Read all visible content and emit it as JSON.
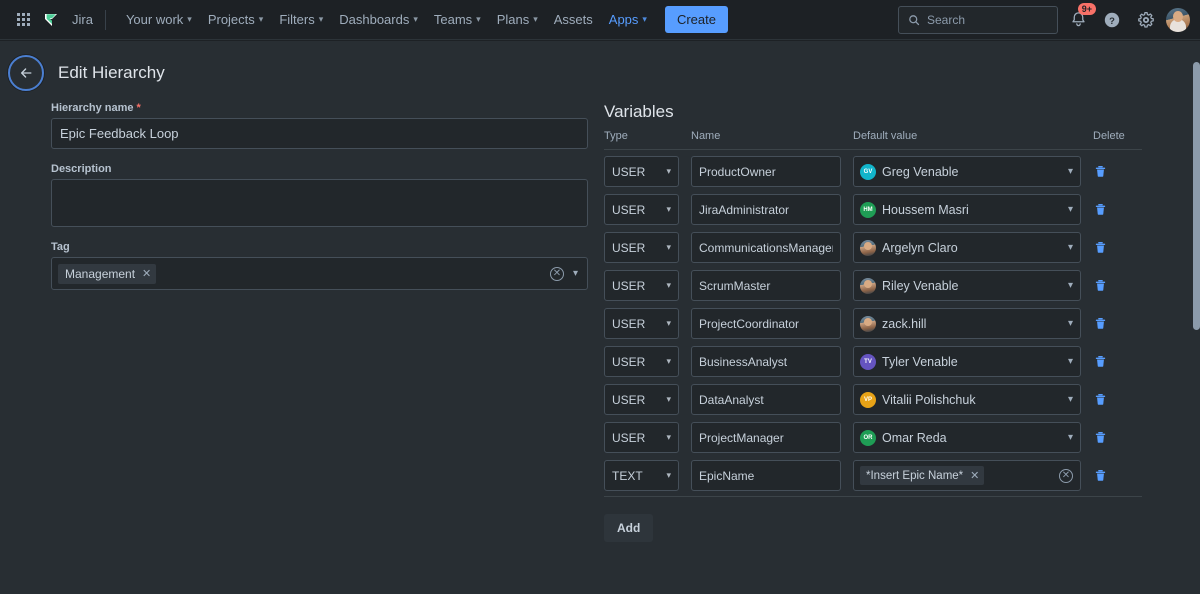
{
  "nav": {
    "app_switcher_icon": "grid-icon",
    "logo_icon": "jira-logo-icon",
    "product": "Jira",
    "items": [
      {
        "label": "Your work",
        "has_caret": true,
        "active": false
      },
      {
        "label": "Projects",
        "has_caret": true,
        "active": false
      },
      {
        "label": "Filters",
        "has_caret": true,
        "active": false
      },
      {
        "label": "Dashboards",
        "has_caret": true,
        "active": false
      },
      {
        "label": "Teams",
        "has_caret": true,
        "active": false
      },
      {
        "label": "Plans",
        "has_caret": true,
        "active": false
      },
      {
        "label": "Assets",
        "has_caret": false,
        "active": false
      },
      {
        "label": "Apps",
        "has_caret": true,
        "active": true
      }
    ],
    "create_label": "Create",
    "search_placeholder": "Search",
    "search_value": "",
    "search_icon": "search-icon",
    "notifications_icon": "bell-icon",
    "notifications_badge": "9+",
    "help_icon": "question-circle-icon",
    "settings_icon": "gear-icon",
    "avatar_icon": "user-avatar",
    "accent_color": "#579dff",
    "badge_color": "#f87168"
  },
  "page": {
    "back_icon": "arrow-left-icon",
    "title": "Edit Hierarchy"
  },
  "form": {
    "hierarchy_name_label": "Hierarchy name",
    "hierarchy_name_required": "*",
    "hierarchy_name_value": "Epic Feedback Loop",
    "description_label": "Description",
    "description_value": "",
    "tag_label": "Tag",
    "tag_chips": [
      {
        "label": "Management",
        "remove_icon": "close-icon"
      }
    ],
    "tag_clear_icon": "clear-circle-icon",
    "tag_chevron_icon": "chevron-down-icon"
  },
  "variables": {
    "title": "Variables",
    "columns": [
      "Type",
      "Name",
      "Default value",
      "Delete"
    ],
    "delete_icon": "trash-icon",
    "chevron_icon": "chevron-down-icon",
    "add_label": "Add",
    "rows": [
      {
        "type": "USER",
        "name": "ProductOwner",
        "value": "Greg Venable",
        "avatar_kind": "initials",
        "initials": "GV",
        "avatar_color": "#12b5cb"
      },
      {
        "type": "USER",
        "name": "JiraAdministrator",
        "value": "Houssem Masri",
        "avatar_kind": "initials",
        "initials": "HM",
        "avatar_color": "#1f9d55"
      },
      {
        "type": "USER",
        "name": "CommunicationsManager",
        "value": "Argelyn Claro",
        "avatar_kind": "photo",
        "initials": "",
        "avatar_color": "#8fa3b5"
      },
      {
        "type": "USER",
        "name": "ScrumMaster",
        "value": "Riley Venable",
        "avatar_kind": "photo",
        "initials": "",
        "avatar_color": "#6d7b8c"
      },
      {
        "type": "USER",
        "name": "ProjectCoordinator",
        "value": "zack.hill",
        "avatar_kind": "photo",
        "initials": "",
        "avatar_color": "#7d6b5a"
      },
      {
        "type": "USER",
        "name": "BusinessAnalyst",
        "value": "Tyler Venable",
        "avatar_kind": "initials",
        "initials": "TV",
        "avatar_color": "#6554c0"
      },
      {
        "type": "USER",
        "name": "DataAnalyst",
        "value": "Vitalii Polishchuk",
        "avatar_kind": "initials",
        "initials": "VP",
        "avatar_color": "#e8a317"
      },
      {
        "type": "USER",
        "name": "ProjectManager",
        "value": "Omar Reda",
        "avatar_kind": "initials",
        "initials": "OR",
        "avatar_color": "#1f9d55"
      },
      {
        "type": "TEXT",
        "name": "EpicName",
        "value": "*Insert Epic Name*",
        "avatar_kind": "chip",
        "initials": "",
        "avatar_color": ""
      }
    ]
  },
  "scrollbar": {
    "visible": true
  }
}
